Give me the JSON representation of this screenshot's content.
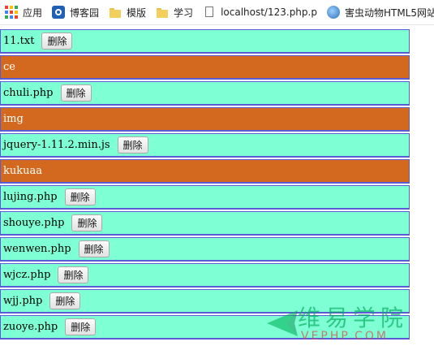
{
  "bookmarks": [
    {
      "label": "应用",
      "icon": "apps-grid-icon"
    },
    {
      "label": "博客园",
      "icon": "cnblogs-icon"
    },
    {
      "label": "模版",
      "icon": "folder-icon"
    },
    {
      "label": "学习",
      "icon": "folder-icon"
    },
    {
      "label": "localhost/123.php.p",
      "icon": "page-icon"
    },
    {
      "label": "害虫动物HTML5网站",
      "icon": "globe-icon"
    }
  ],
  "files": [
    {
      "name": "11.txt",
      "is_dir": false,
      "action": "删除"
    },
    {
      "name": "ce",
      "is_dir": true
    },
    {
      "name": "chuli.php",
      "is_dir": false,
      "action": "删除"
    },
    {
      "name": "img",
      "is_dir": true
    },
    {
      "name": "jquery-1.11.2.min.js",
      "is_dir": false,
      "action": "删除"
    },
    {
      "name": "kukuaa",
      "is_dir": true
    },
    {
      "name": "lujing.php",
      "is_dir": false,
      "action": "删除"
    },
    {
      "name": "shouye.php",
      "is_dir": false,
      "action": "删除"
    },
    {
      "name": "wenwen.php",
      "is_dir": false,
      "action": "删除"
    },
    {
      "name": "wjcz.php",
      "is_dir": false,
      "action": "删除"
    },
    {
      "name": "wjj.php",
      "is_dir": false,
      "action": "删除"
    },
    {
      "name": "zuoye.php",
      "is_dir": false,
      "action": "删除"
    }
  ],
  "colors": {
    "file_row_bg": "#7fffd4",
    "dir_row_bg": "#d2691e",
    "row_border": "#5b5bd6"
  },
  "watermark": {
    "text": "维易学院",
    "sub": "VEPHP.COM"
  }
}
